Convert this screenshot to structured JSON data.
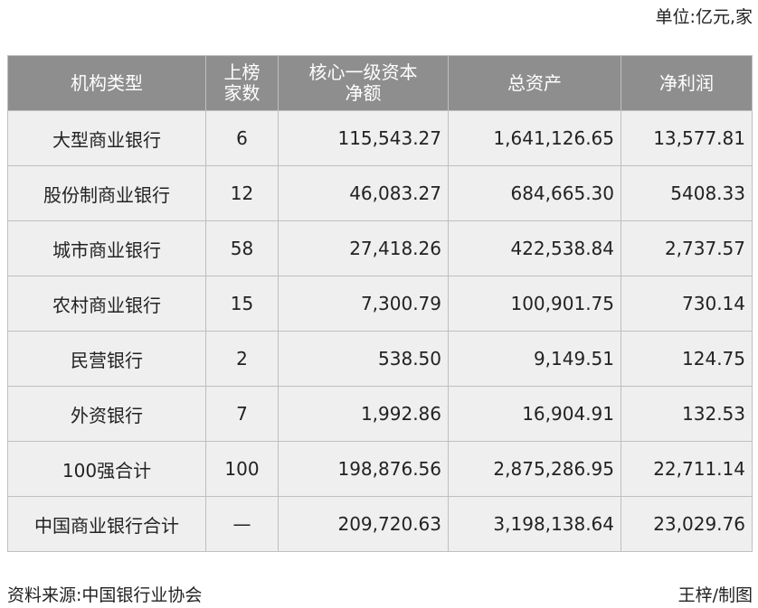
{
  "unit_note": "单位:亿元,家",
  "table": {
    "headers": {
      "type": "机构类型",
      "count_line1": "上榜",
      "count_line2": "家数",
      "capital_line1": "核心一级资本",
      "capital_line2": "净额",
      "assets": "总资产",
      "profit": "净利润"
    },
    "rows": [
      {
        "type": "大型商业银行",
        "count": "6",
        "capital": "115,543.27",
        "assets": "1,641,126.65",
        "profit": "13,577.81"
      },
      {
        "type": "股份制商业银行",
        "count": "12",
        "capital": "46,083.27",
        "assets": "684,665.30",
        "profit": "5408.33"
      },
      {
        "type": "城市商业银行",
        "count": "58",
        "capital": "27,418.26",
        "assets": "422,538.84",
        "profit": "2,737.57"
      },
      {
        "type": "农村商业银行",
        "count": "15",
        "capital": "7,300.79",
        "assets": "100,901.75",
        "profit": "730.14"
      },
      {
        "type": "民营银行",
        "count": "2",
        "capital": "538.50",
        "assets": "9,149.51",
        "profit": "124.75"
      },
      {
        "type": "外资银行",
        "count": "7",
        "capital": "1,992.86",
        "assets": "16,904.91",
        "profit": "132.53"
      },
      {
        "type": "100强合计",
        "count": "100",
        "capital": "198,876.56",
        "assets": "2,875,286.95",
        "profit": "22,711.14"
      },
      {
        "type": "中国商业银行合计",
        "count": "—",
        "capital": "209,720.63",
        "assets": "3,198,138.64",
        "profit": "23,029.76"
      }
    ]
  },
  "footer": {
    "source": "资料来源:中国银行业协会",
    "credit": "王梓/制图"
  }
}
